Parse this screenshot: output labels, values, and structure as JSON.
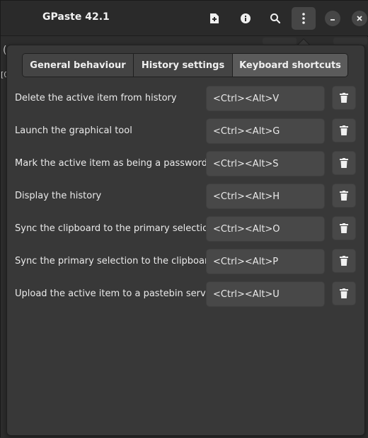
{
  "header": {
    "title": "GPaste 42.1",
    "icons": [
      "new-item-icon",
      "info-icon",
      "search-icon",
      "menu-icon",
      "minimize-icon",
      "close-icon"
    ]
  },
  "tabs": [
    {
      "label": "General behaviour",
      "selected": false
    },
    {
      "label": "History settings",
      "selected": false
    },
    {
      "label": "Keyboard shortcuts",
      "selected": true
    }
  ],
  "shortcuts": [
    {
      "label": "Delete the active item from history",
      "value": "<Ctrl><Alt>V"
    },
    {
      "label": "Launch the graphical tool",
      "value": "<Ctrl><Alt>G"
    },
    {
      "label": "Mark the active item as being a password",
      "value": "<Ctrl><Alt>S"
    },
    {
      "label": "Display the history",
      "value": "<Ctrl><Alt>H"
    },
    {
      "label": "Sync the clipboard to the primary selection",
      "value": "<Ctrl><Alt>O"
    },
    {
      "label": "Sync the primary selection to the clipboard",
      "value": "<Ctrl><Alt>P"
    },
    {
      "label": "Upload the active item to a pastebin service",
      "value": "<Ctrl><Alt>U"
    }
  ],
  "background": {
    "fragment_1": "(",
    "fragment_2": "[0"
  },
  "colors": {
    "window_bg": "#2d2d2d",
    "popover_bg": "#383838",
    "selected_tab": "#5b5b5b"
  }
}
